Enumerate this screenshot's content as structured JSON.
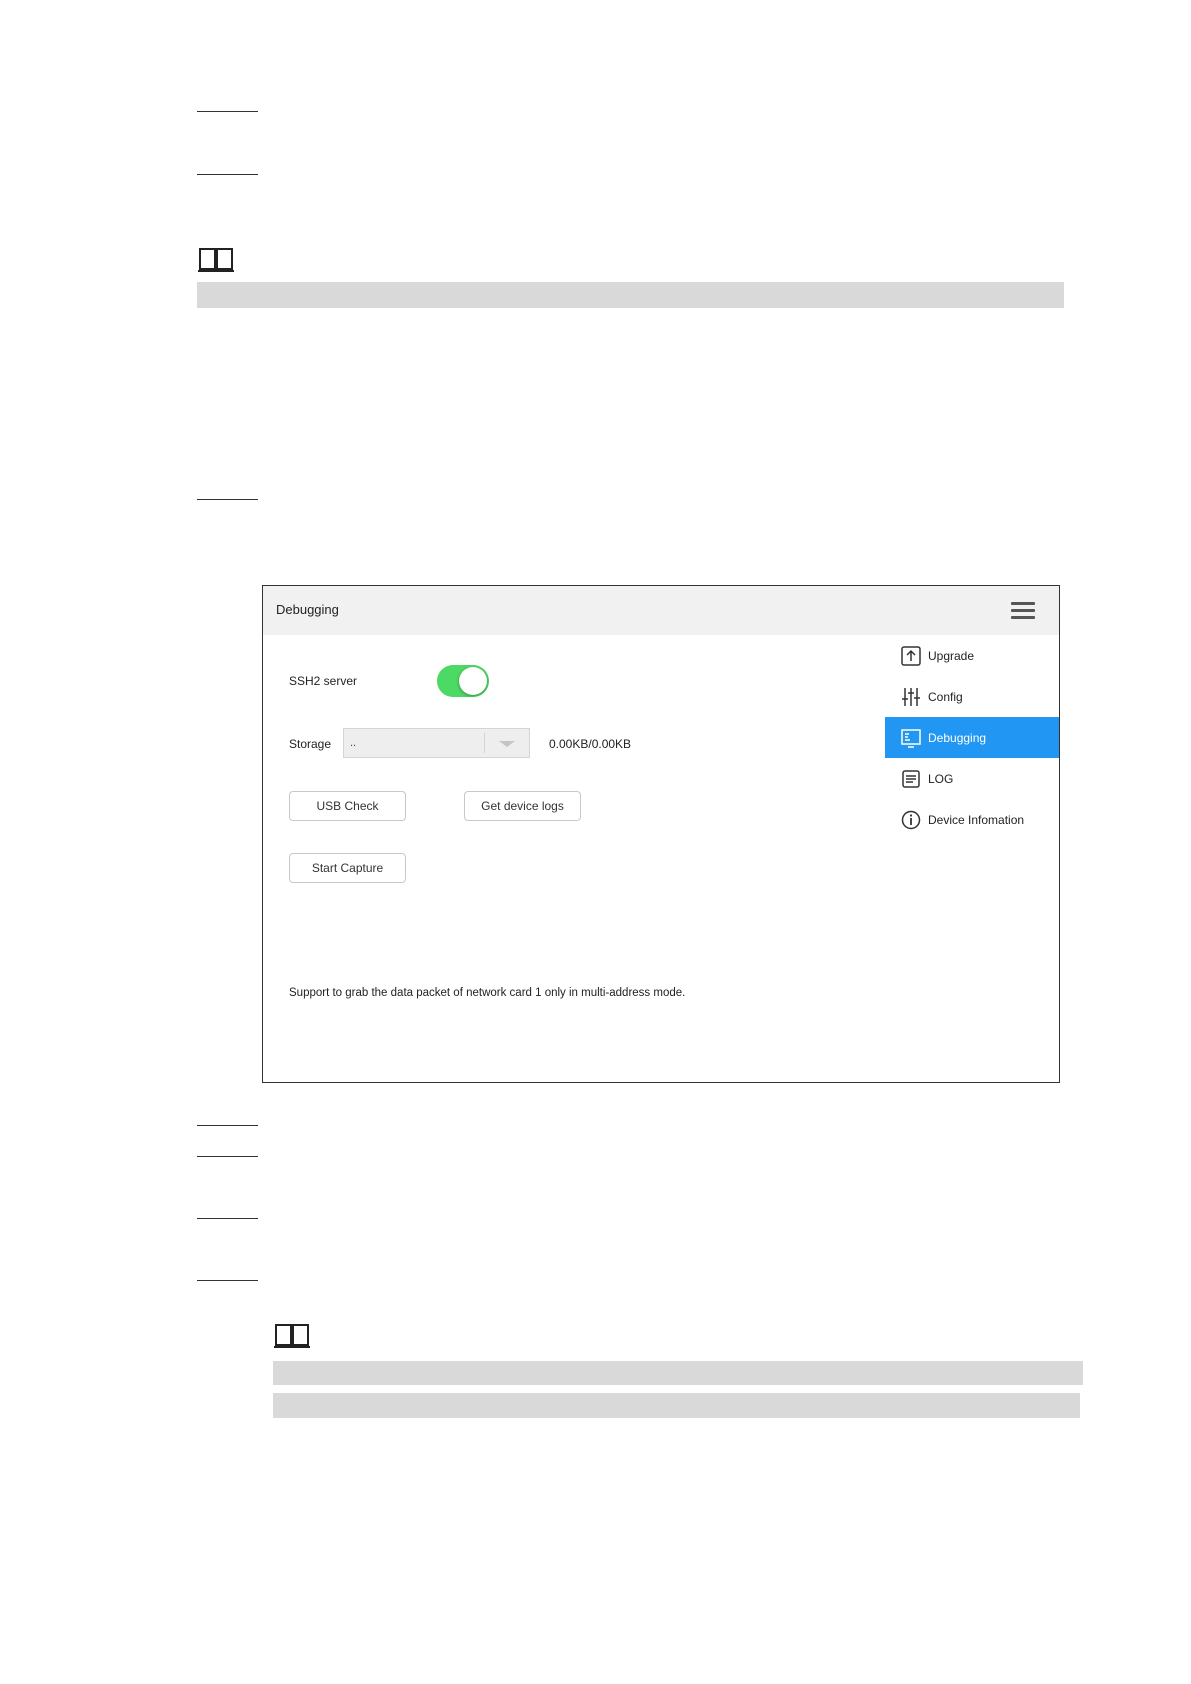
{
  "panel": {
    "title": "Debugging",
    "ssh": {
      "label": "SSH2 server",
      "enabled": true
    },
    "storage": {
      "label": "Storage",
      "selected": "..",
      "usage": "0.00KB/0.00KB"
    },
    "buttons": {
      "usb_check": "USB Check",
      "get_logs": "Get device logs",
      "start_capture": "Start Capture"
    },
    "note": "Support to grab the data packet of network card 1 only in multi-address mode."
  },
  "sidebar": {
    "items": [
      {
        "label": "Upgrade",
        "icon": "upload-icon",
        "active": false
      },
      {
        "label": "Config",
        "icon": "sliders-icon",
        "active": false
      },
      {
        "label": "Debugging",
        "icon": "terminal-icon",
        "active": true
      },
      {
        "label": "LOG",
        "icon": "log-icon",
        "active": false
      },
      {
        "label": "Device Infomation",
        "icon": "info-icon",
        "active": false
      }
    ]
  },
  "colors": {
    "toggle_on": "#4cd964",
    "active_item": "#2196f3",
    "header_bg": "#f1f1f1"
  }
}
